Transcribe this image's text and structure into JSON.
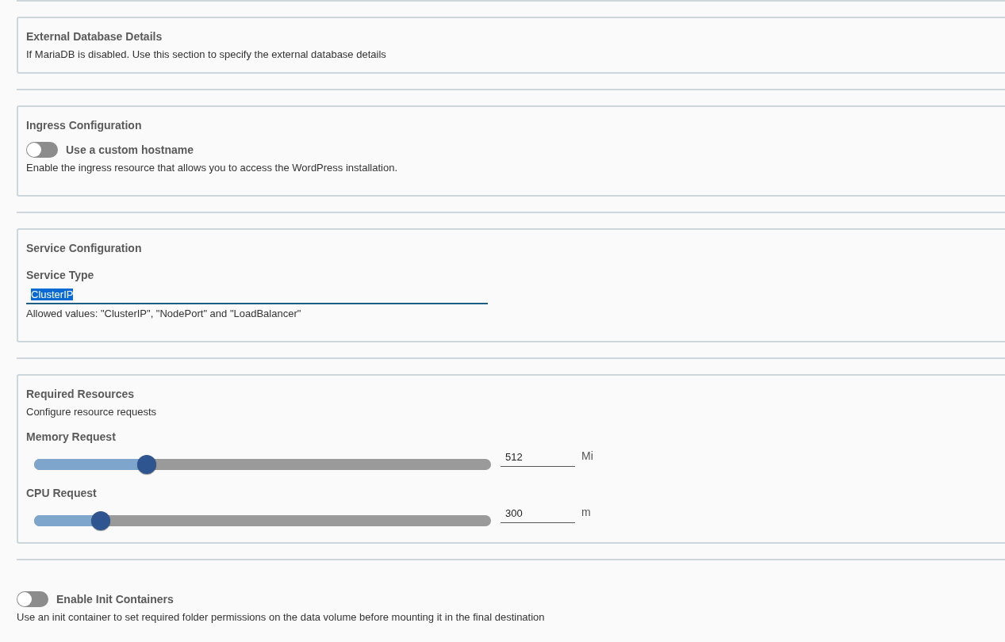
{
  "sections": [
    {
      "boxed": true,
      "title": "External Database Details",
      "items": [
        {
          "kind": "description",
          "text": "If MariaDB is disabled. Use this section to specify the external database details"
        }
      ]
    },
    {
      "boxed": true,
      "title": "Ingress Configuration",
      "items": [
        {
          "kind": "toggle",
          "label": "Use a custom hostname",
          "on": false
        },
        {
          "kind": "description",
          "text": "Enable the ingress resource that allows you to access the WordPress installation."
        }
      ]
    },
    {
      "boxed": true,
      "title": "Service Configuration",
      "items": [
        {
          "kind": "text-field",
          "label": "Service Type",
          "value": "ClusterIP",
          "text_selected": true
        },
        {
          "kind": "description",
          "text": "Allowed values: \"ClusterIP\", \"NodePort\" and \"LoadBalancer\""
        }
      ]
    },
    {
      "boxed": true,
      "title": "Required Resources",
      "items": [
        {
          "kind": "description",
          "text": "Configure resource requests"
        },
        {
          "kind": "slider",
          "label": "Memory Request",
          "level": 0.247,
          "value": "512",
          "unit": "Mi"
        },
        {
          "kind": "slider",
          "label": "CPU Request",
          "level": 0.146,
          "value": "300",
          "unit": "m"
        }
      ]
    },
    {
      "boxed": false,
      "items": [
        {
          "kind": "toggle",
          "label": "Enable Init Containers",
          "on": false
        },
        {
          "kind": "description",
          "text": "Use an init container to set required folder permissions on the data volume before mounting it in the final destination"
        }
      ]
    }
  ]
}
